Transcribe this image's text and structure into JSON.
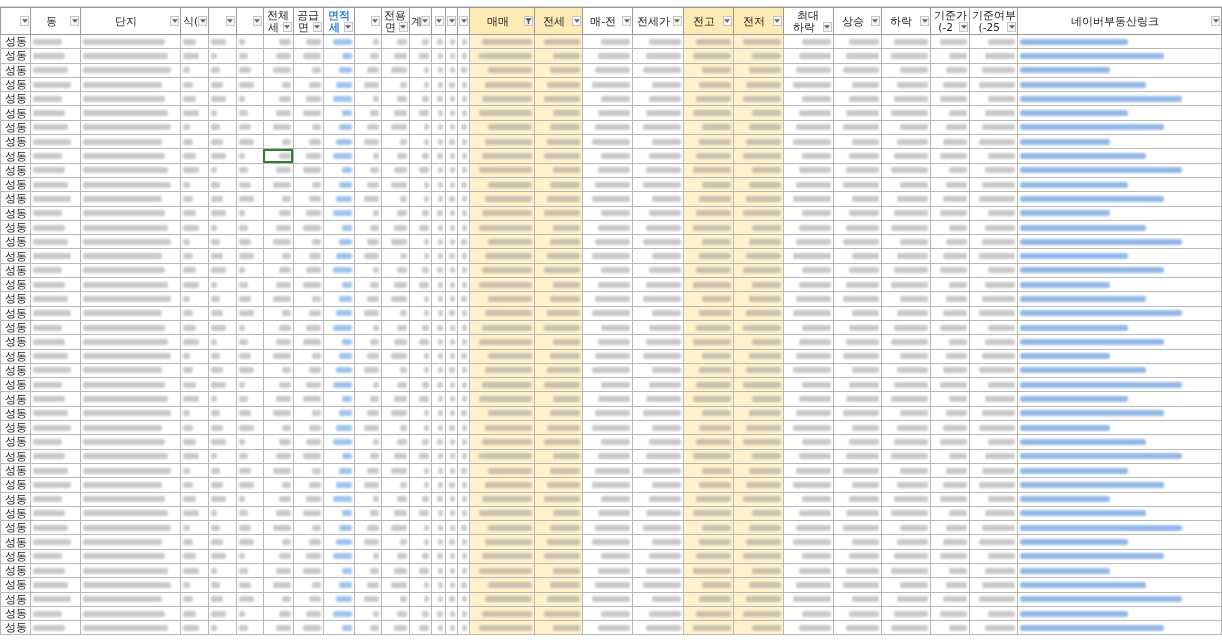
{
  "columns": [
    {
      "filtered": false,
      "highlight": false
    },
    {
      "header": [
        "동"
      ],
      "filtered": false,
      "highlight": false
    },
    {
      "header": [
        "단지"
      ],
      "filtered": false,
      "highlight": false
    },
    {
      "header": [
        "식("
      ],
      "filtered": false,
      "highlight": false
    },
    {
      "filtered": false,
      "highlight": false
    },
    {
      "filtered": false,
      "highlight": false
    },
    {
      "header": [
        "전체",
        "세"
      ],
      "filtered": false,
      "highlight": false
    },
    {
      "header": [
        "공급",
        "면"
      ],
      "filtered": false,
      "highlight": false
    },
    {
      "header": [
        "면적",
        "세"
      ],
      "filtered": false,
      "highlight": false,
      "color": "#2f7fd8"
    },
    {
      "filtered": false,
      "highlight": false
    },
    {
      "header": [
        "전용",
        "면"
      ],
      "filtered": false,
      "highlight": false
    },
    {
      "header": [
        "계"
      ],
      "filtered": false,
      "highlight": false
    },
    {
      "filtered": false,
      "highlight": false
    },
    {
      "filtered": false,
      "highlight": false
    },
    {
      "filtered": false,
      "highlight": false
    },
    {
      "header": [
        "매매"
      ],
      "filtered": true,
      "highlight": true
    },
    {
      "header": [
        "전세"
      ],
      "filtered": false,
      "highlight": true
    },
    {
      "header": [
        "매-전"
      ],
      "filtered": false,
      "highlight": false
    },
    {
      "header": [
        "전세가"
      ],
      "filtered": false,
      "highlight": false
    },
    {
      "header": [
        "전고"
      ],
      "filtered": false,
      "highlight": true
    },
    {
      "header": [
        "전저"
      ],
      "filtered": false,
      "highlight": true
    },
    {
      "header": [
        "최대",
        "하락"
      ],
      "filtered": false,
      "highlight": false
    },
    {
      "header": [
        "상승"
      ],
      "filtered": false,
      "highlight": false
    },
    {
      "header": [
        "하락"
      ],
      "filtered": false,
      "highlight": false
    },
    {
      "header": [
        "기준가",
        "(-2"
      ],
      "filtered": false,
      "highlight": false
    },
    {
      "header": [
        "기준여부",
        "(-25"
      ],
      "filtered": false,
      "highlight": false
    },
    {
      "header": [
        "네이버부동산링크"
      ],
      "filtered": false,
      "highlight": false,
      "kind": "link"
    }
  ],
  "rows": [
    {
      "district": "성동",
      "selected": false
    },
    {
      "district": "성동",
      "selected": false
    },
    {
      "district": "성동",
      "selected": false
    },
    {
      "district": "성동",
      "selected": false
    },
    {
      "district": "성동",
      "selected": false
    },
    {
      "district": "성동",
      "selected": false
    },
    {
      "district": "성동",
      "selected": false
    },
    {
      "district": "성동",
      "selected": false
    },
    {
      "district": "성동",
      "selected": true
    },
    {
      "district": "성동",
      "selected": false
    },
    {
      "district": "성동",
      "selected": false
    },
    {
      "district": "성동",
      "selected": false
    },
    {
      "district": "성동",
      "selected": false
    },
    {
      "district": "성동",
      "selected": false
    },
    {
      "district": "성동",
      "selected": false
    },
    {
      "district": "성동",
      "selected": false
    },
    {
      "district": "성동",
      "selected": false
    },
    {
      "district": "성동",
      "selected": false
    },
    {
      "district": "성동",
      "selected": false
    },
    {
      "district": "성동",
      "selected": false
    },
    {
      "district": "성동",
      "selected": false
    },
    {
      "district": "성동",
      "selected": false
    },
    {
      "district": "성동",
      "selected": false
    },
    {
      "district": "성동",
      "selected": false
    },
    {
      "district": "성동",
      "selected": false
    },
    {
      "district": "성동",
      "selected": false
    },
    {
      "district": "성동",
      "selected": false
    },
    {
      "district": "성동",
      "selected": false
    },
    {
      "district": "성동",
      "selected": false
    },
    {
      "district": "성동",
      "selected": false
    },
    {
      "district": "성동",
      "selected": false
    },
    {
      "district": "성동",
      "selected": false
    },
    {
      "district": "성동",
      "selected": false
    },
    {
      "district": "성동",
      "selected": false
    },
    {
      "district": "성동",
      "selected": false
    },
    {
      "district": "성동",
      "selected": false
    },
    {
      "district": "성동",
      "selected": false
    },
    {
      "district": "성동",
      "selected": false
    },
    {
      "district": "성동",
      "selected": false
    },
    {
      "district": "성동",
      "selected": false
    },
    {
      "district": "성동",
      "selected": false
    },
    {
      "district": "성동",
      "selected": false
    }
  ]
}
